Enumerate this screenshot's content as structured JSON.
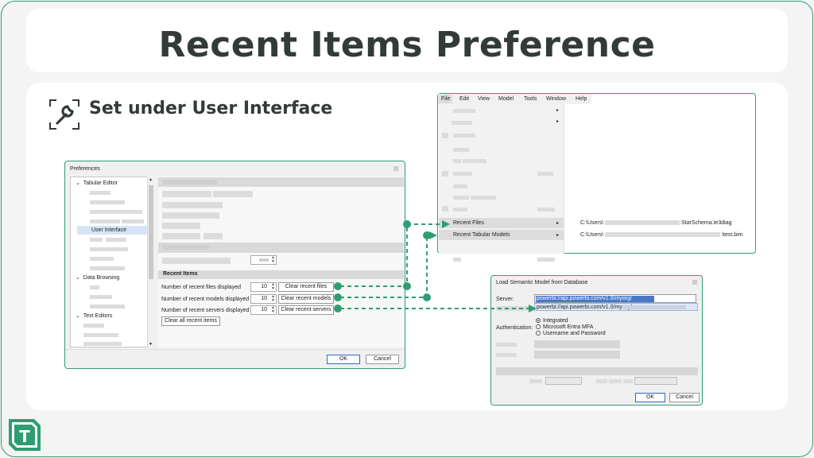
{
  "slide": {
    "title": "Recent Items Preference",
    "subtitle": "Set under User Interface",
    "subtitle_icon": "wrench-icon",
    "logo_icon": "tabular-editor-logo",
    "logo_letter": "T",
    "accent_color": "#2e9e72"
  },
  "preferences": {
    "title": "Preferences",
    "tree": {
      "tabular_editor": "Tabular Editor",
      "user_interface": "User Interface",
      "data_browsing": "Data Browsing",
      "text_editors": "Text Editors"
    },
    "recent_items": {
      "header": "Recent Items",
      "rows": [
        {
          "label": "Number of recent files displayed",
          "value": "10",
          "button": "Clear recent files"
        },
        {
          "label": "Number of recent models displayed",
          "value": "10",
          "button": "Clear recent models"
        },
        {
          "label": "Number of recent servers displayed",
          "value": "10",
          "button": "Clear recent servers"
        }
      ],
      "clear_all": "Clear all recent items"
    },
    "ok": "OK",
    "cancel": "Cancel"
  },
  "file_menu": {
    "menubar": [
      "File",
      "Edit",
      "View",
      "Model",
      "Tools",
      "Window",
      "Help"
    ],
    "recent_files": {
      "label": "Recent Files",
      "path_prefix": "C:\\Users\\",
      "path_suffix": "StarSchema.te3diag"
    },
    "recent_models": {
      "label": "Recent Tabular Models",
      "path_prefix": "C:\\Users\\",
      "path_suffix": "\\test.bim"
    }
  },
  "load_model": {
    "title": "Load Semantic Model from Database",
    "server_label": "Server:",
    "server_value": "powerbi://api.powerbi.com/v1.0/myorg/",
    "suggestion": "powerbi://api.powerbi.com/v1.0/myorg/",
    "auth_label": "Authentication:",
    "auth_options": [
      "Integrated",
      "Microsoft Entra MFA",
      "Username and Password"
    ],
    "ok": "OK",
    "cancel": "Cancel"
  }
}
